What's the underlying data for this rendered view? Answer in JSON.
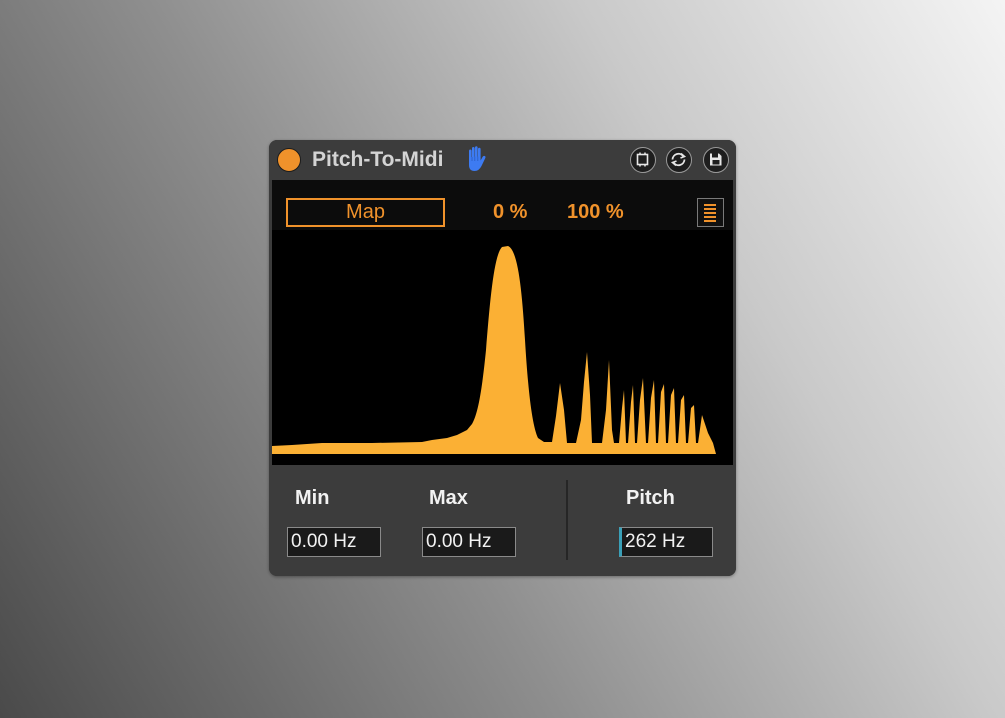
{
  "device": {
    "title": "Pitch-To-Midi",
    "icons": {
      "power": "power-led-icon",
      "hand": "hand-icon",
      "freeze": "freeze-icon",
      "refresh": "refresh-icon",
      "save": "save-icon"
    }
  },
  "topbar": {
    "map_label": "Map",
    "min_percent": "0 %",
    "max_percent": "100 %",
    "menu_icon": "list-icon"
  },
  "controls": {
    "min_label": "Min",
    "min_value": "0.00 Hz",
    "max_label": "Max",
    "max_value": "0.00 Hz",
    "pitch_label": "Pitch",
    "pitch_value": "262 Hz"
  },
  "colors": {
    "accent": "#f0922b",
    "spectrum_fill": "#fbb034",
    "device_bg": "#3c3c3c",
    "display_bg": "#000000",
    "hand_icon": "#3d7bf2"
  }
}
